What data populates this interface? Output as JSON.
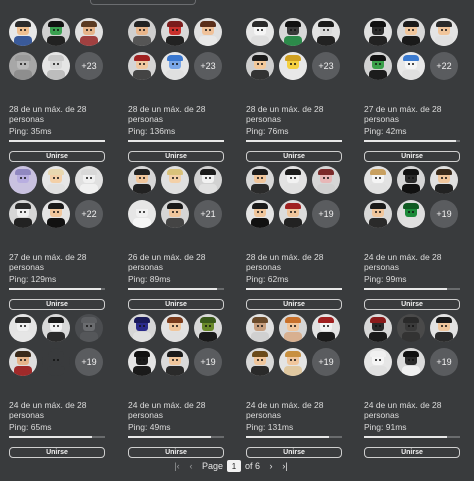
{
  "servers": [
    {
      "players": "28 de un máx. de 28 personas",
      "ping": "Ping: 35ms",
      "more": "+23",
      "fill": 1.0,
      "join": "Unirse",
      "avatars": [
        {
          "bg": "#e8e8e8",
          "skin": "#f0c090",
          "hair": "#2b2b2b",
          "shirt": "#3a5a9a"
        },
        {
          "bg": "#d0d0d0",
          "skin": "#3aa050",
          "hair": "#111",
          "shirt": "#222"
        },
        {
          "bg": "#e0e0e0",
          "skin": "#e6b48a",
          "hair": "#5a3a22",
          "shirt": "#a04040"
        },
        {
          "bg": "#a7a7a7",
          "skin": "#b9b9b9",
          "hair": "#9a9a9a",
          "shirt": "#8e8e8e"
        },
        {
          "bg": "#e5e5e5",
          "skin": "#d8d8d8",
          "hair": "#c8c8c8",
          "shirt": "#bdbdbd"
        }
      ]
    },
    {
      "players": "28 de un máx. de 28 personas",
      "ping": "Ping: 136ms",
      "more": "+23",
      "fill": 1.0,
      "join": "Unirse",
      "avatars": [
        {
          "bg": "#cfcfcf",
          "skin": "#e8b58a",
          "hair": "#222",
          "shirt": "#555"
        },
        {
          "bg": "#d9d9d9",
          "skin": "#c9302c",
          "hair": "#7a1c1c",
          "shirt": "#222"
        },
        {
          "bg": "#e0e0e0",
          "skin": "#f0c29a",
          "hair": "#5a2e1a",
          "shirt": "#e8e8e8"
        },
        {
          "bg": "#d5d5d5",
          "skin": "#f0c8a0",
          "hair": "#a02020",
          "shirt": "#444"
        },
        {
          "bg": "#e6e6e6",
          "skin": "#7aa7e8",
          "hair": "#3a78d0",
          "shirt": "#e0e0e0"
        }
      ]
    },
    {
      "players": "28 de un máx. de 28 personas",
      "ping": "Ping: 76ms",
      "more": "+23",
      "fill": 1.0,
      "join": "Unirse",
      "avatars": [
        {
          "bg": "#e6e6e6",
          "skin": "#f5f5f5",
          "hair": "#2a2a2a",
          "shirt": "#ddd"
        },
        {
          "bg": "#d8d8d8",
          "skin": "#3a3a3a",
          "hair": "#111",
          "shirt": "#2c8a4a"
        },
        {
          "bg": "#e2e2e2",
          "skin": "#d9d9d9",
          "hair": "#1a1a1a",
          "shirt": "#222"
        },
        {
          "bg": "#cfcfcf",
          "skin": "#f3c99b",
          "hair": "#1a1a1a",
          "shirt": "#333"
        },
        {
          "bg": "#e7e7e7",
          "skin": "#f4d040",
          "hair": "#d0a020",
          "shirt": "#e8e8e8"
        }
      ]
    },
    {
      "players": "27 de un máx. de 28 personas",
      "ping": "Ping: 42ms",
      "more": "+22",
      "fill": 0.96,
      "join": "Unirse",
      "avatars": [
        {
          "bg": "#e0e0e0",
          "skin": "#2a2a2a",
          "hair": "#111",
          "shirt": "#222"
        },
        {
          "bg": "#d8d8d8",
          "skin": "#f0c69c",
          "hair": "#1a1a1a",
          "shirt": "#1a1a1a"
        },
        {
          "bg": "#e4e4e4",
          "skin": "#f1c59a",
          "hair": "#2a2a2a",
          "shirt": "#e0e0e0"
        },
        {
          "bg": "#d2d2d2",
          "skin": "#3aa04a",
          "hair": "#111",
          "shirt": "#1c1c1c"
        },
        {
          "bg": "#e8e8e8",
          "skin": "#f5f5f5",
          "hair": "#3a7ad0",
          "shirt": "#e0e0e0"
        }
      ]
    },
    {
      "players": "27 de un máx. de 28 personas",
      "ping": "Ping: 129ms",
      "more": "+22",
      "fill": 0.96,
      "join": "Unirse",
      "avatars": [
        {
          "bg": "#c9c2e0",
          "skin": "#b8aee0",
          "hair": "#9088c0",
          "shirt": "#c9c2e0"
        },
        {
          "bg": "#e6e6e6",
          "skin": "#f3d0a8",
          "hair": "#e8d8b0",
          "shirt": "#e0e0e0"
        },
        {
          "bg": "#e0e0e0",
          "skin": "#f0f0f0",
          "hair": "#d8d8d8",
          "shirt": "#f0f0f0"
        },
        {
          "bg": "#d6d6d6",
          "skin": "#f0f0f0",
          "hair": "#2a2a2a",
          "shirt": "#222"
        },
        {
          "bg": "#e4e4e4",
          "skin": "#f0c69c",
          "hair": "#1a1a1a",
          "shirt": "#111"
        }
      ]
    },
    {
      "players": "26 de un máx. de 28 personas",
      "ping": "Ping: 89ms",
      "more": "+21",
      "fill": 0.93,
      "join": "Unirse",
      "avatars": [
        {
          "bg": "#d8d8d8",
          "skin": "#f0c69c",
          "hair": "#222",
          "shirt": "#222"
        },
        {
          "bg": "#e0e0e0",
          "skin": "#f3d0a8",
          "hair": "#d9c27a",
          "shirt": "#e0e0e0"
        },
        {
          "bg": "#d2d2d2",
          "skin": "#f2f2f2",
          "hair": "#1a1a1a",
          "shirt": "#e0e0e0"
        },
        {
          "bg": "#e6e6e6",
          "skin": "#f0f0f0",
          "hair": "#e6e6e6",
          "shirt": "#f5f5f5"
        },
        {
          "bg": "#d5d5d5",
          "skin": "#f0c69c",
          "hair": "#1a1a1a",
          "shirt": "#444"
        }
      ]
    },
    {
      "players": "28 de un máx. de 28 personas",
      "ping": "Ping: 62ms",
      "more": "+19",
      "fill": 1.0,
      "join": "Unirse",
      "avatars": [
        {
          "bg": "#d8d8d8",
          "skin": "#f0c69c",
          "hair": "#1a1a1a",
          "shirt": "#2a2a2a"
        },
        {
          "bg": "#e2e2e2",
          "skin": "#f2f2f2",
          "hair": "#1a1a1a",
          "shirt": "#e0e0e0"
        },
        {
          "bg": "#d6d6d6",
          "skin": "#e7b7b7",
          "hair": "#7a2a2a",
          "shirt": "#d0d0d0"
        },
        {
          "bg": "#e4e4e4",
          "skin": "#f0c69c",
          "hair": "#1a1a1a",
          "shirt": "#111"
        },
        {
          "bg": "#dcdcdc",
          "skin": "#f0c69c",
          "hair": "#a02020",
          "shirt": "#222"
        }
      ]
    },
    {
      "players": "24 de un máx. de 28 personas",
      "ping": "Ping: 99ms",
      "more": "+19",
      "fill": 0.86,
      "join": "Unirse",
      "avatars": [
        {
          "bg": "#e2e2e2",
          "skin": "#f5f5f5",
          "hair": "#c8a060",
          "shirt": "#e0e0e0"
        },
        {
          "bg": "#d6d6d6",
          "skin": "#2a2a2a",
          "hair": "#111",
          "shirt": "#111"
        },
        {
          "bg": "#e0e0e0",
          "skin": "#f0c69c",
          "hair": "#3a2a1a",
          "shirt": "#222"
        },
        {
          "bg": "#d8d8d8",
          "skin": "#f0c69c",
          "hair": "#1a1a1a",
          "shirt": "#2a2a2a"
        },
        {
          "bg": "#dedede",
          "skin": "#1c8a3a",
          "hair": "#0f5a22",
          "shirt": "#e0e0e0"
        }
      ]
    },
    {
      "players": "24 de un máx. de 28 personas",
      "ping": "Ping: 65ms",
      "more": "+19",
      "fill": 0.86,
      "join": "Unirse",
      "avatars": [
        {
          "bg": "#e4e4e4",
          "skin": "#f0f0f0",
          "hair": "#2a2a2a",
          "shirt": "#e6e6e6"
        },
        {
          "bg": "#d8d8d8",
          "skin": "#f3f3f3",
          "hair": "#1a1a1a",
          "shirt": "#2a2a2a"
        },
        {
          "bg": "#4b4d50",
          "skin": "#6a6c6f",
          "hair": "#5c5e61",
          "shirt": "#55575a"
        },
        {
          "bg": "#dedede",
          "skin": "#e6b48a",
          "hair": "#3a2a1a",
          "shirt": "#a02a2a"
        },
        {
          "bg": "#393b3d",
          "skin": "#393b3d",
          "hair": "#393b3d",
          "shirt": "#393b3d"
        }
      ]
    },
    {
      "players": "24 de un máx. de 28 personas",
      "ping": "Ping: 49ms",
      "more": "+19",
      "fill": 0.86,
      "join": "Unirse",
      "avatars": [
        {
          "bg": "#d6d6d6",
          "skin": "#2a2a8a",
          "hair": "#1a1a5a",
          "shirt": "#e0e0e0"
        },
        {
          "bg": "#e2e2e2",
          "skin": "#f0c69c",
          "hair": "#7a3a1a",
          "shirt": "#e0e0e0"
        },
        {
          "bg": "#d8d8d8",
          "skin": "#6a8a2a",
          "hair": "#3a5a1a",
          "shirt": "#1a1a1a"
        },
        {
          "bg": "#e4e4e4",
          "skin": "#1a1a1a",
          "hair": "#111",
          "shirt": "#1a1a1a"
        },
        {
          "bg": "#dadada",
          "skin": "#f0c69c",
          "hair": "#1a1a1a",
          "shirt": "#2a2a2a"
        }
      ]
    },
    {
      "players": "24 de un máx. de 28 personas",
      "ping": "Ping: 131ms",
      "more": "+19",
      "fill": 0.86,
      "join": "Unirse",
      "avatars": [
        {
          "bg": "#e0e0e0",
          "skin": "#c8a080",
          "hair": "#6a4a2a",
          "shirt": "#d0d0d0"
        },
        {
          "bg": "#d6d6d6",
          "skin": "#f0c69c",
          "hair": "#c8702a",
          "shirt": "#d8b090"
        },
        {
          "bg": "#e2e2e2",
          "skin": "#f2f2f2",
          "hair": "#a02020",
          "shirt": "#1a1a1a"
        },
        {
          "bg": "#d8d8d8",
          "skin": "#f0c69c",
          "hair": "#6a4a1a",
          "shirt": "#2a2a2a"
        },
        {
          "bg": "#e4e4e4",
          "skin": "#f0c69c",
          "hair": "#c89040",
          "shirt": "#e0c8a0"
        }
      ]
    },
    {
      "players": "24 de un máx. de 28 personas",
      "ping": "Ping: 91ms",
      "more": "+19",
      "fill": 0.86,
      "join": "Unirse",
      "avatars": [
        {
          "bg": "#d8d8d8",
          "skin": "#2a2a2a",
          "hair": "#8a1a1a",
          "shirt": "#1a1a1a"
        },
        {
          "bg": "#4a4a4a",
          "skin": "#3a3a3a",
          "hair": "#2a2a2a",
          "shirt": "#333"
        },
        {
          "bg": "#e2e2e2",
          "skin": "#f0c69c",
          "hair": "#1a1a1a",
          "shirt": "#2a2a2a"
        },
        {
          "bg": "#e6e6e6",
          "skin": "#f5f5f5",
          "hair": "#f0f0f0",
          "shirt": "#e0e0e0"
        },
        {
          "bg": "#dadada",
          "skin": "#2a2a2a",
          "hair": "#111",
          "shirt": "#f0f0f0"
        }
      ]
    }
  ],
  "pagination": {
    "label": "Page",
    "current": "1",
    "of": "of 6",
    "first_icon": "first-page-icon",
    "prev_icon": "prev-page-icon",
    "next_icon": "next-page-icon",
    "last_icon": "last-page-icon"
  }
}
